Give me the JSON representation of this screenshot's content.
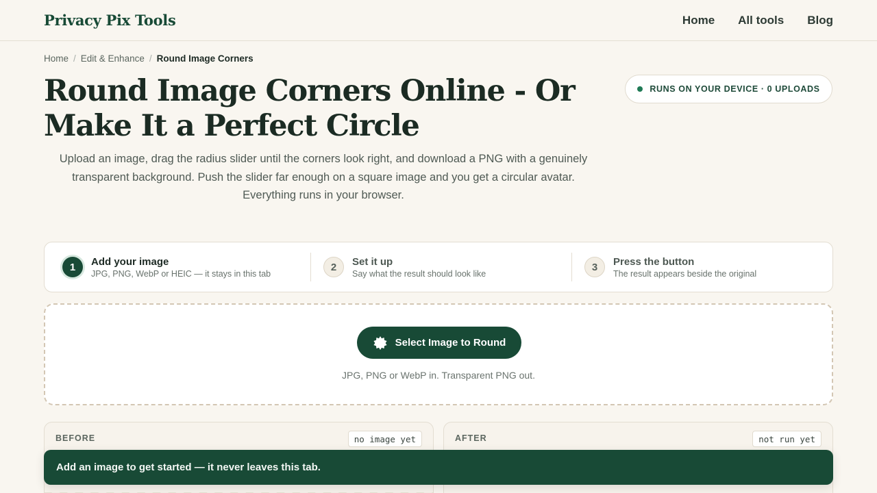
{
  "header": {
    "brand": "Privacy Pix Tools",
    "nav": [
      "Home",
      "All tools",
      "Blog"
    ]
  },
  "breadcrumb": [
    "Home",
    "Edit & Enhance",
    "Round Image Corners"
  ],
  "page_title": "Round Image Corners Online - Or Make It a Perfect Circle",
  "device_badge": "RUNS ON YOUR DEVICE · 0 UPLOADS",
  "intro": "Upload an image, drag the radius slider until the corners look right, and download a PNG with a genuinely transparent background. Push the slider far enough on a square image and you get a circular avatar. Everything runs in your browser.",
  "steps": [
    {
      "num": "1",
      "title": "Add your image",
      "desc": "JPG, PNG, WebP or HEIC — it stays in this tab"
    },
    {
      "num": "2",
      "title": "Set it up",
      "desc": "Say what the result should look like"
    },
    {
      "num": "3",
      "title": "Press the button",
      "desc": "The result appears beside the original"
    }
  ],
  "dropzone": {
    "button_label": "Select Image to Round",
    "hint": "JPG, PNG or WebP in. Transparent PNG out."
  },
  "panels": {
    "before": {
      "label": "BEFORE",
      "tag": "no image yet"
    },
    "after": {
      "label": "AFTER",
      "tag": "not run yet"
    }
  },
  "toast": "Add an image to get started — it never leaves this tab.",
  "colors": {
    "brand": "#184a36",
    "background": "#f9f6f0",
    "status_dot": "#1f7a55"
  }
}
